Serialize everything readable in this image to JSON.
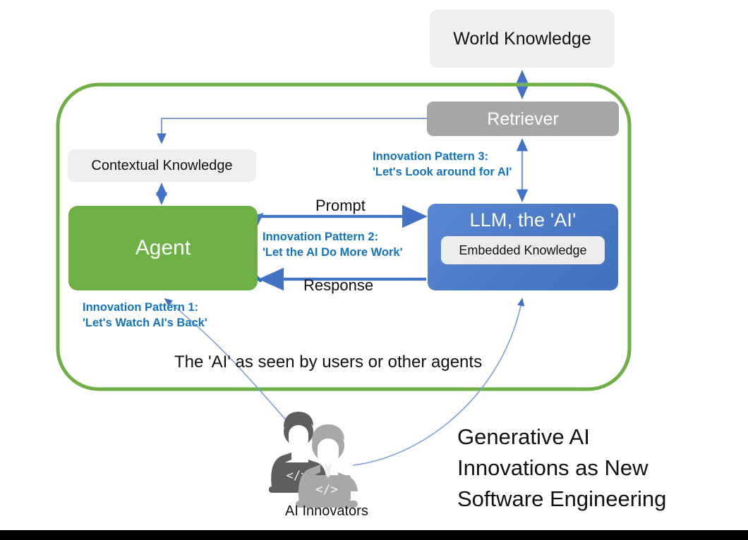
{
  "diagram": {
    "title_block": "Generative AI\nInnovations as New\nSoftware Engineering",
    "title_lines": [
      "Generative AI",
      "Innovations as New",
      "Software Engineering"
    ],
    "caption": "The 'AI' as seen by users or other agents"
  },
  "nodes": {
    "world_knowledge": {
      "label": "World Knowledge",
      "fill": "#efefef",
      "text_color": "#111111"
    },
    "retriever": {
      "label": "Retriever",
      "fill": "#a6a6a6",
      "text_color": "#ffffff"
    },
    "contextual_knowledge": {
      "label": "Contextual Knowledge",
      "fill": "#efefef",
      "text_color": "#111111"
    },
    "agent": {
      "label": "Agent",
      "fill": "#6eaf46",
      "text_color": "#ffffff"
    },
    "llm": {
      "label": "LLM, the 'AI'",
      "fill": "#4a79c6",
      "text_color": "#ffffff"
    },
    "embedded_knowledge": {
      "label": "Embedded Knowledge",
      "fill": "#ececec",
      "text_color": "#111111"
    },
    "innovators": {
      "label": "AI Innovators",
      "icon": "two-people-with-laptops-icon"
    }
  },
  "edges": {
    "prompt": {
      "label": "Prompt",
      "from": "agent",
      "to": "llm"
    },
    "response": {
      "label": "Response",
      "from": "llm",
      "to": "agent"
    }
  },
  "patterns": {
    "pattern_1": {
      "line1": "Innovation Pattern 1:",
      "line2": "'Let's Watch AI's Back'",
      "color": "#1274bd"
    },
    "pattern_2": {
      "line1": "Innovation Pattern 2:",
      "line2": "'Let the AI Do More Work'",
      "color": "#1274bd"
    },
    "pattern_3": {
      "line1": "Innovation Pattern 3:",
      "line2": "'Let's Look around for AI'",
      "color": "#1274bd"
    }
  },
  "colors": {
    "boundary_green": "#6eaf46",
    "arrow_blue": "#4472c4",
    "thin_arrow_blue": "#7f9fd4",
    "accent_blue_text": "#1274bd",
    "bottom_bar": "#000000",
    "canvas": "#ffffff"
  }
}
